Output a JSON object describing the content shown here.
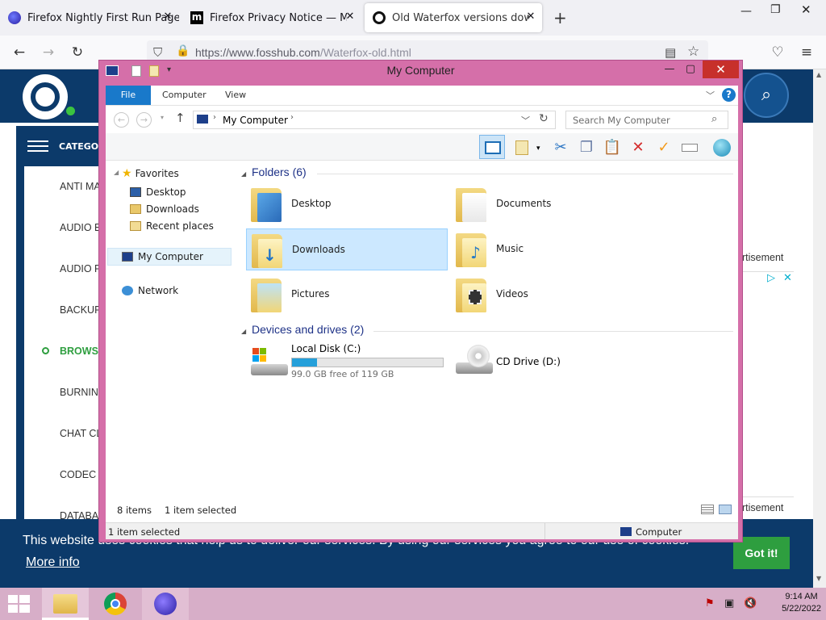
{
  "browser": {
    "tabs": [
      {
        "title": "Firefox Nightly First Run Page",
        "icon": "firefox-nightly-icon"
      },
      {
        "title": "Firefox Privacy Notice — Mozilla",
        "icon": "mozilla-m-icon"
      },
      {
        "title": "Old Waterfox versions downloa",
        "icon": "fosshub-icon",
        "active": true
      }
    ],
    "url_host": "https://www.fosshub.com",
    "url_path": "/Waterfox-old.html"
  },
  "website": {
    "category_label": "CATEGOR",
    "categories": [
      {
        "label": "ANTI MA"
      },
      {
        "label": "AUDIO E"
      },
      {
        "label": "AUDIO F"
      },
      {
        "label": "BACKUP"
      },
      {
        "label": "BROWS",
        "active": true
      },
      {
        "label": "BURNIN"
      },
      {
        "label": "CHAT CL"
      },
      {
        "label": "CODEC I"
      },
      {
        "label": "DATABA"
      }
    ],
    "ad_label_1": "rtisement",
    "ad_label_2": "rtisement",
    "cookie_text": "This website uses cookies that help us to deliver our services. By using our services you agree to our use of cookies.",
    "more_info": "More info",
    "got_it": "Got it!",
    "accent_color": "#0c3a6a"
  },
  "explorer": {
    "title": "My Computer",
    "ribbon_tabs": [
      "File",
      "Computer",
      "View"
    ],
    "address": "My Computer",
    "search_placeholder": "Search My Computer",
    "nav": {
      "favorites": "Favorites",
      "favorite_items": [
        "Desktop",
        "Downloads",
        "Recent places"
      ],
      "computer": "My Computer",
      "network": "Network"
    },
    "folders_header": "Folders (6)",
    "folders": [
      {
        "name": "Desktop"
      },
      {
        "name": "Documents"
      },
      {
        "name": "Downloads",
        "selected": true
      },
      {
        "name": "Music"
      },
      {
        "name": "Pictures"
      },
      {
        "name": "Videos"
      }
    ],
    "drives_header": "Devices and drives (2)",
    "drives": [
      {
        "name": "Local Disk (C:)",
        "free": "99.0 GB free of 119 GB",
        "used_fraction": 0.168
      },
      {
        "name": "CD Drive (D:)"
      }
    ],
    "status_items": "8 items",
    "status_selected": "1 item selected",
    "statusbar_left": "1 item selected",
    "statusbar_right": "Computer",
    "frame_color": "#d56fa9"
  },
  "taskbar": {
    "time": "9:14 AM",
    "date": "5/22/2022"
  }
}
